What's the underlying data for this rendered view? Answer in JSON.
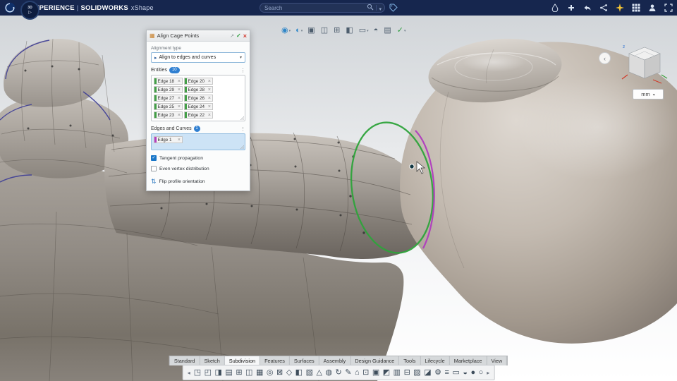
{
  "header": {
    "brand": "3DEXPERIENCE",
    "divider": "|",
    "app": "SOLIDWORKS",
    "module": "xShape",
    "badge_3d": "3D",
    "badge_play": "▷",
    "search": {
      "placeholder": "Search"
    },
    "icon_names": [
      "ink-drop-icon",
      "add-icon",
      "share-icon",
      "collaborate-icon",
      "favorites-sparkle-icon",
      "apps-grid-icon",
      "user-icon",
      "fullscreen-icon"
    ]
  },
  "view_toolbar": {
    "icons": [
      {
        "name": "render-style-icon",
        "glyph": "◉",
        "color": "#2e86c8",
        "caret": "▾"
      },
      {
        "name": "display-mode-icon",
        "glyph": "◐",
        "color": "#2e86c8",
        "caret": "▾"
      },
      {
        "name": "ground-shadow-icon",
        "glyph": "▣",
        "color": "#4d5d6d",
        "caret": ""
      },
      {
        "name": "background-icon",
        "glyph": "◫",
        "color": "#4d5d6d",
        "caret": ""
      },
      {
        "name": "grid-icon",
        "glyph": "⊞",
        "color": "#4d5d6d",
        "caret": ""
      },
      {
        "name": "section-view-icon",
        "glyph": "◧",
        "color": "#4d5d6d",
        "caret": ""
      },
      {
        "name": "frame-view-icon",
        "glyph": "▭",
        "color": "#4d5d6d",
        "caret": "▾"
      },
      {
        "name": "shading-icon",
        "glyph": "◓",
        "color": "#4d5d6d",
        "caret": ""
      },
      {
        "name": "selection-list-icon",
        "glyph": "▤",
        "color": "#4d5d6d",
        "caret": ""
      },
      {
        "name": "validate-selection-icon",
        "glyph": "✓",
        "color": "#2f9e3f",
        "caret": "▾"
      }
    ]
  },
  "panel": {
    "title": "Align Cage Points",
    "title_icon_glyph": "▦",
    "detach_glyph": "↗",
    "ok_glyph": "✓",
    "close_glyph": "×",
    "alignment_label": "Alignment type",
    "alignment_icon_glyph": "▸",
    "alignment_value": "Align to edges and curves",
    "entities_label": "Entities",
    "entities_count": "10",
    "entity_chips": [
      "Edge 18",
      "Edge 20",
      "Edge 29",
      "Edge 28",
      "Edge 27",
      "Edge 26",
      "Edge 25",
      "Edge 24",
      "Edge 23",
      "Edge 22"
    ],
    "edges_label": "Edges and Curves",
    "edges_count": "1",
    "edge_chips": [
      "Edge 1"
    ],
    "tangent_label": "Tangent propagation",
    "tangent_checked": true,
    "even_label": "Even vertex distribution",
    "even_checked": false,
    "flip_icon_glyph": "⇅",
    "flip_label": "Flip profile orientation"
  },
  "viewcube": {
    "unit": "mm",
    "collapse_glyph": "‹",
    "axis_z": "z"
  },
  "tabs": {
    "items": [
      "Standard",
      "Sketch",
      "Subdivision",
      "Features",
      "Surfaces",
      "Assembly",
      "Design Guidance",
      "Tools",
      "Lifecycle",
      "Marketplace",
      "View"
    ],
    "active_tab": "Subdivision"
  },
  "bottom_toolbar": {
    "left_arrow": "◂",
    "right_arrow": "▸",
    "icons": [
      "◳",
      "◰",
      "◨",
      "▤",
      "⊞",
      "◫",
      "▦",
      "◎",
      "⊠",
      "◇",
      "◧",
      "▧",
      "△",
      "◍",
      "↻",
      "✎",
      "⌂",
      "⊡",
      "▣",
      "◩",
      "▥",
      "⊟",
      "▨",
      "◪",
      "⚙",
      "≡",
      "▭",
      "◒",
      "●",
      "○"
    ]
  }
}
